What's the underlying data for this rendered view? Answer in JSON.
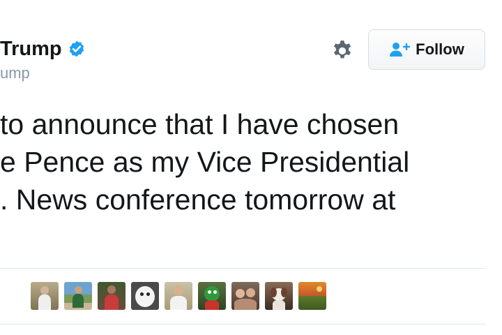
{
  "header": {
    "name": "Trump",
    "handle": "ump",
    "verified": true,
    "follow_label": "Follow",
    "icons": {
      "verified": "verified-badge-icon",
      "settings": "gear-icon",
      "follow": "person-add-icon"
    }
  },
  "tweet": {
    "lines": [
      "to announce that I have chosen",
      "e Pence as my Vice Presidential",
      ". News conference tomorrow at"
    ]
  },
  "liked_by_avatars": [
    {
      "name": "avatar-1"
    },
    {
      "name": "avatar-2"
    },
    {
      "name": "avatar-3"
    },
    {
      "name": "avatar-4"
    },
    {
      "name": "avatar-5"
    },
    {
      "name": "avatar-6"
    },
    {
      "name": "avatar-7"
    },
    {
      "name": "avatar-8"
    },
    {
      "name": "avatar-9"
    },
    {
      "name": "avatar-10"
    }
  ],
  "colors": {
    "accent": "#1da1f2",
    "text": "#14171a",
    "muted": "#8899a6",
    "divider": "#e1e8ed"
  }
}
